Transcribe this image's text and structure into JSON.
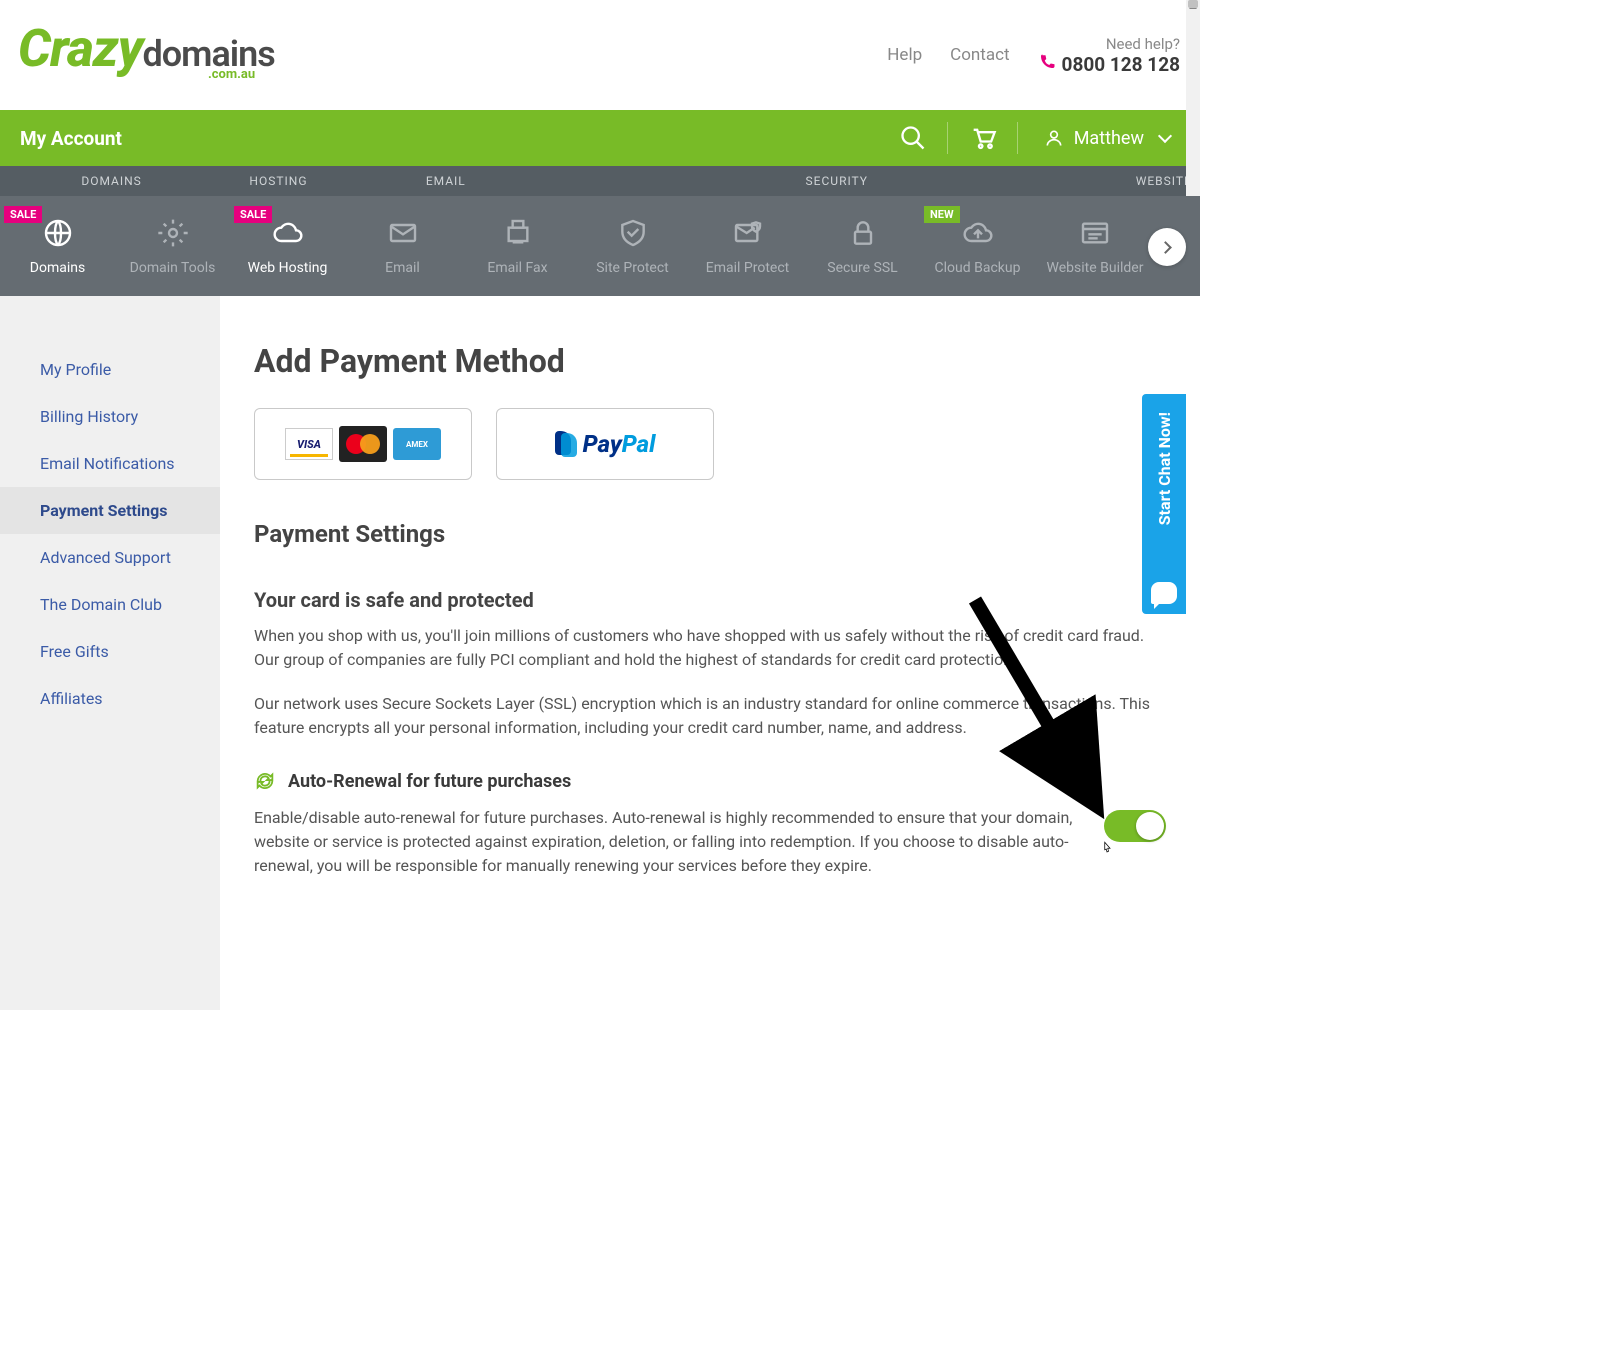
{
  "header": {
    "logo_brand": "Crazy",
    "logo_word": "domains",
    "logo_sub": ".com.au",
    "help": "Help",
    "contact": "Contact",
    "need_help": "Need help?",
    "phone": "0800 128 128"
  },
  "greenbar": {
    "title": "My Account",
    "user": "Matthew"
  },
  "categories": {
    "labels": [
      "DOMAINS",
      "HOSTING",
      "EMAIL",
      "SECURITY",
      "WEBSITES"
    ],
    "tiles": [
      {
        "label": "Domains",
        "badge": "SALE"
      },
      {
        "label": "Domain Tools",
        "badge": null
      },
      {
        "label": "Web Hosting",
        "badge": "SALE"
      },
      {
        "label": "Email",
        "badge": null
      },
      {
        "label": "Email Fax",
        "badge": null
      },
      {
        "label": "Site Protect",
        "badge": null
      },
      {
        "label": "Email Protect",
        "badge": null
      },
      {
        "label": "Secure SSL",
        "badge": null
      },
      {
        "label": "Cloud Backup",
        "badge": "NEW"
      },
      {
        "label": "Website Builder",
        "badge": null
      }
    ]
  },
  "sidebar": {
    "items": [
      "My Profile",
      "Billing History",
      "Email Notifications",
      "Payment Settings",
      "Advanced Support",
      "The Domain Club",
      "Free Gifts",
      "Affiliates"
    ],
    "active_index": 3
  },
  "content": {
    "h1": "Add Payment Method",
    "payment_option_cards_label": "Credit Cards",
    "payment_option_paypal_label": "PayPal",
    "section_title": "Payment Settings",
    "safe_title": "Your card is safe and protected",
    "safe_p1": "When you shop with us, you'll join millions of customers who have shopped with us safely without the risk of credit card fraud. Our group of companies are fully PCI compliant and hold the highest of standards for credit card protection.",
    "safe_p2": "Our network uses Secure Sockets Layer (SSL) encryption which is an industry standard for online commerce transactions. This feature encrypts all your personal information, including your credit card number, name, and address.",
    "renewal_title": "Auto-Renewal for future purchases",
    "renewal_body": "Enable/disable auto-renewal for future purchases. Auto-renewal is highly recommended to ensure that your domain, website or service is protected against expiration, deletion, or falling into redemption. If you choose to disable auto-renewal, you will be responsible for manually renewing your services before they expire.",
    "toggle_on": true
  },
  "chat": {
    "label": "Start Chat Now!"
  }
}
